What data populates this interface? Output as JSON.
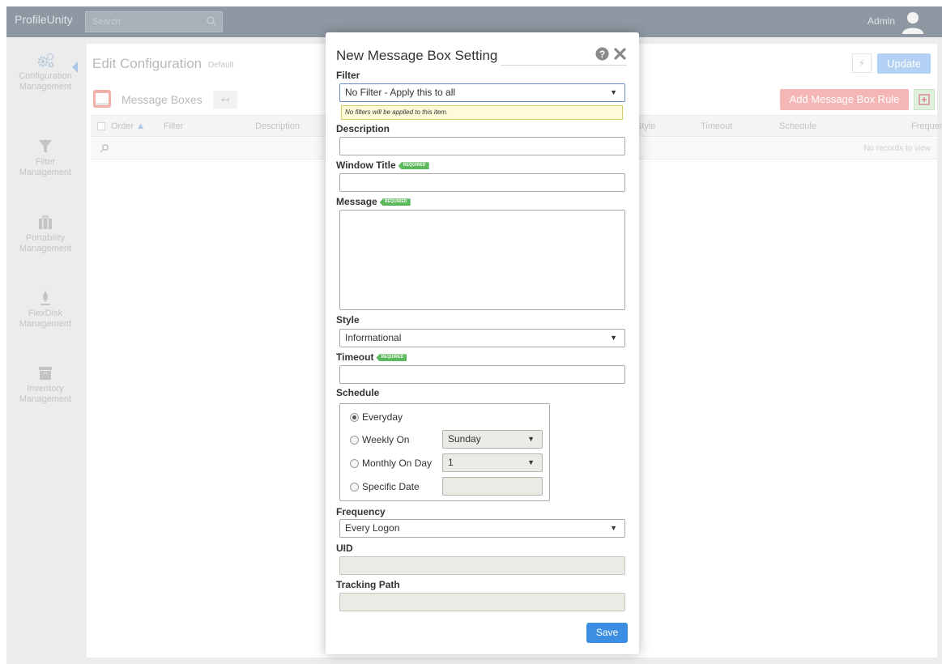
{
  "app": {
    "brand": "ProfileUnity",
    "search_placeholder": "Search",
    "user": "Admin"
  },
  "sidebar": {
    "items": [
      {
        "line1": "Configuration",
        "line2": "Management",
        "icon": "gears-icon"
      },
      {
        "line1": "Filter",
        "line2": "Management",
        "icon": "funnel-icon"
      },
      {
        "line1": "Portability",
        "line2": "Management",
        "icon": "briefcase-icon"
      },
      {
        "line1": "FlexDisk",
        "line2": "Management",
        "icon": "flexdisk-icon"
      },
      {
        "line1": "Inventory",
        "line2": "Management",
        "icon": "archive-icon"
      }
    ]
  },
  "page": {
    "title": "Edit Configuration",
    "subtitle": "Default",
    "update_label": "Update",
    "section_label": "Message Boxes",
    "add_rule_label": "Add Message Box Rule",
    "columns": [
      "Order",
      "Filter",
      "Description",
      "Style",
      "Timeout",
      "Schedule",
      "Frequen"
    ],
    "empty_text": "No records to view"
  },
  "modal": {
    "title": "New Message Box Setting",
    "required_badge": "REQUIRED",
    "filter": {
      "label": "Filter",
      "value": "No Filter - Apply this to all",
      "note": "No filters will be applied to this item."
    },
    "description": {
      "label": "Description",
      "value": ""
    },
    "window_title": {
      "label": "Window Title",
      "value": ""
    },
    "message": {
      "label": "Message",
      "value": ""
    },
    "style": {
      "label": "Style",
      "value": "Informational"
    },
    "timeout": {
      "label": "Timeout",
      "value": ""
    },
    "schedule": {
      "label": "Schedule",
      "options": [
        {
          "label": "Everyday",
          "selected": true
        },
        {
          "label": "Weekly On",
          "selected": false,
          "select_value": "Sunday"
        },
        {
          "label": "Monthly On Day",
          "selected": false,
          "select_value": "1"
        },
        {
          "label": "Specific Date",
          "selected": false,
          "input_value": ""
        }
      ]
    },
    "frequency": {
      "label": "Frequency",
      "value": "Every Logon"
    },
    "uid": {
      "label": "UID",
      "value": ""
    },
    "tracking_path": {
      "label": "Tracking Path",
      "value": ""
    },
    "save_label": "Save"
  },
  "colors": {
    "accent": "#3b8ee2",
    "required": "#5cb85c",
    "danger_faded": "#f5b6b6",
    "topbar": "#8f98a2"
  }
}
